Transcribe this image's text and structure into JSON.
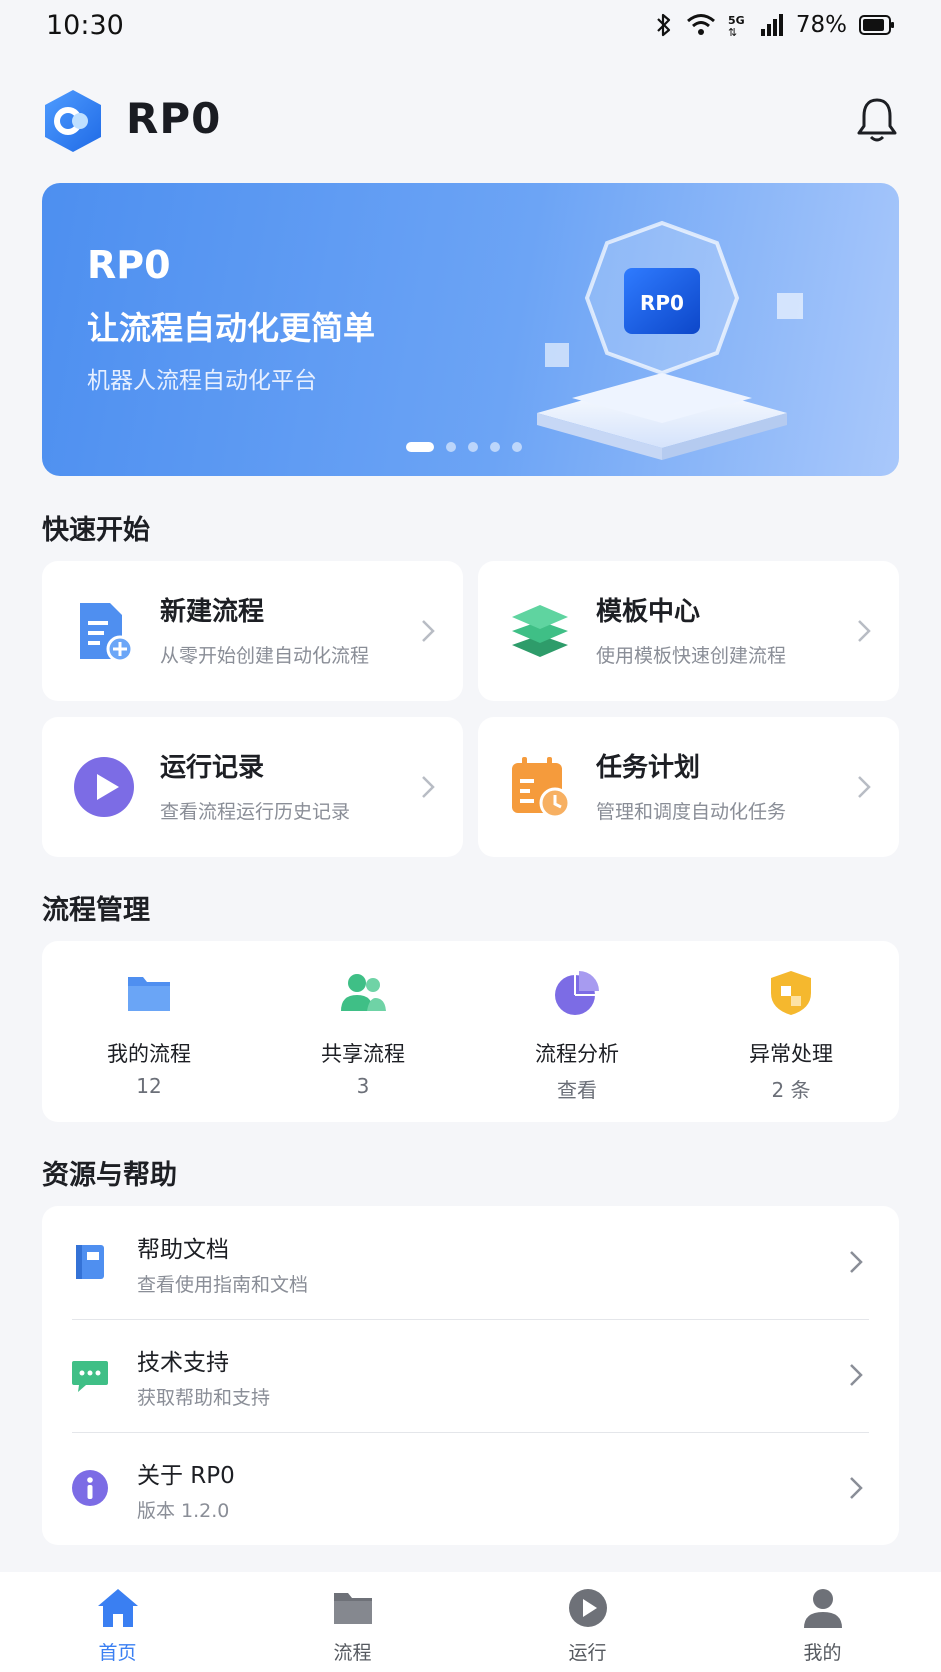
{
  "status_bar": {
    "time": "10:30",
    "network": "5G",
    "battery": "78%"
  },
  "header": {
    "title": "RP0",
    "logo_icon": "hexagon-logo-icon",
    "bell_icon": "bell-icon"
  },
  "banner": {
    "title": "RP0",
    "subtitle": "让流程自动化更简单",
    "description": "机器人流程自动化平台",
    "art_label": "RP0",
    "page_count": 5,
    "active_page": 1
  },
  "quick_start": {
    "title": "快速开始",
    "items": [
      {
        "title": "新建流程",
        "desc": "从零开始创建自动化流程",
        "icon": "new-document-icon"
      },
      {
        "title": "模板中心",
        "desc": "使用模板快速创建流程",
        "icon": "layers-icon"
      },
      {
        "title": "运行记录",
        "desc": "查看流程运行历史记录",
        "icon": "play-circle-icon"
      },
      {
        "title": "任务计划",
        "desc": "管理和调度自动化任务",
        "icon": "calendar-clock-icon"
      }
    ]
  },
  "management": {
    "title": "流程管理",
    "items": [
      {
        "label": "我的流程",
        "value": "12",
        "icon": "folder-icon"
      },
      {
        "label": "共享流程",
        "value": "3",
        "icon": "users-icon"
      },
      {
        "label": "流程分析",
        "value": "查看",
        "icon": "pie-chart-icon"
      },
      {
        "label": "异常处理",
        "value": "2 条",
        "icon": "shield-warning-icon"
      }
    ]
  },
  "resources": {
    "title": "资源与帮助",
    "items": [
      {
        "title": "帮助文档",
        "desc": "查看使用指南和文档",
        "icon": "book-icon"
      },
      {
        "title": "技术支持",
        "desc": "获取帮助和支持",
        "icon": "chat-bubble-icon"
      },
      {
        "title": "关于 RP0",
        "desc": "版本 1.2.0",
        "icon": "info-icon"
      }
    ]
  },
  "tabbar": {
    "active": "首页",
    "items": [
      {
        "label": "首页",
        "icon": "home-icon"
      },
      {
        "label": "流程",
        "icon": "folder-icon"
      },
      {
        "label": "运行",
        "icon": "play-circle-icon"
      },
      {
        "label": "我的",
        "icon": "user-icon"
      }
    ]
  },
  "colors": {
    "accent": "#3a7ff2",
    "green": "#3fbf86",
    "purple": "#7c6ce5",
    "orange": "#f59b3c",
    "yellow": "#f5b82e",
    "background": "#f5f6f9"
  }
}
